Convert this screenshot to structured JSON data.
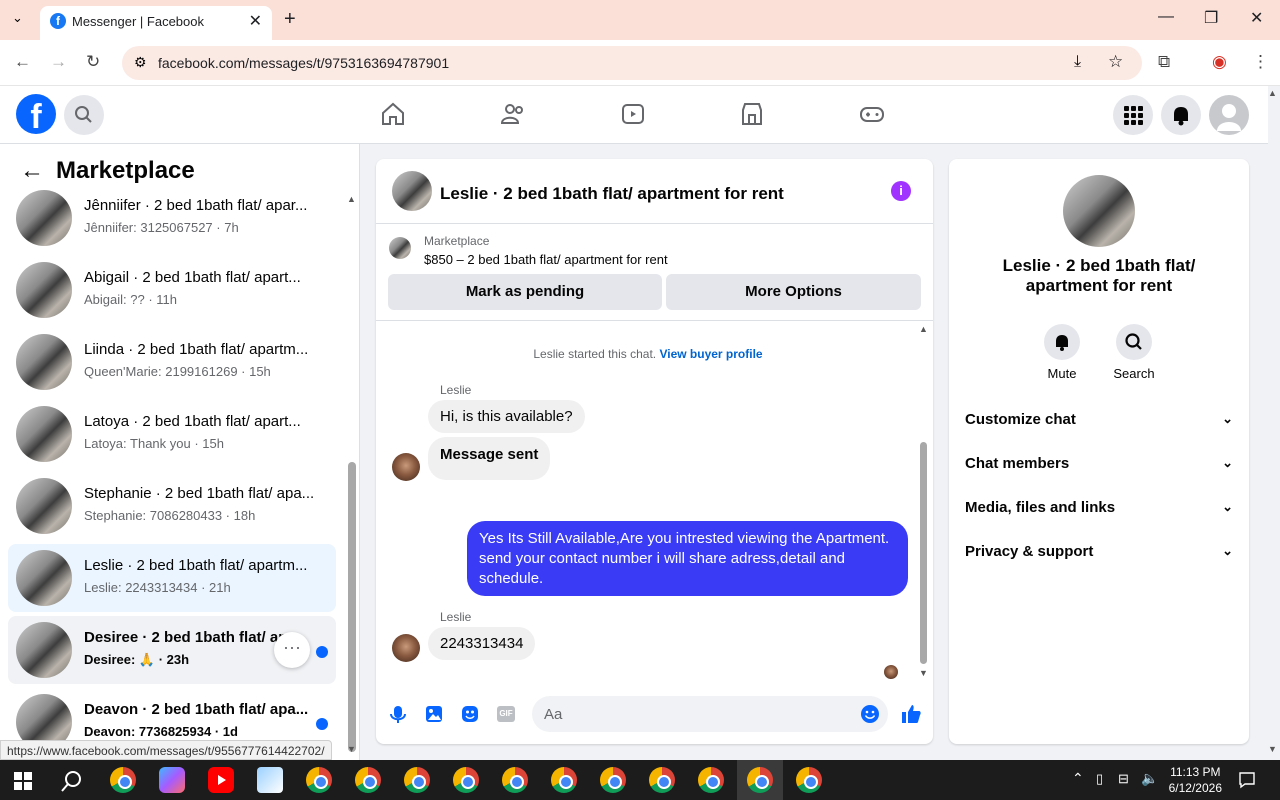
{
  "browser": {
    "tab_title": "Messenger | Facebook",
    "url": "facebook.com/messages/t/9753163694787901"
  },
  "left": {
    "title": "Marketplace",
    "conversations": [
      {
        "name": "Jênniifer · 2 bed 1bath flat/ apar...",
        "sub": "Jênniifer: 3125067527 · 7h"
      },
      {
        "name": "Abigail · 2 bed 1bath flat/ apart...",
        "sub": "Abigail: ?? · 11h"
      },
      {
        "name": "Liinda · 2 bed 1bath flat/ apartm...",
        "sub": "Queen'Marie: 2199161269 · 15h"
      },
      {
        "name": "Latoya · 2 bed 1bath flat/ apart...",
        "sub": "Latoya: Thank you · 15h"
      },
      {
        "name": "Stephanie · 2 bed 1bath flat/ apa...",
        "sub": "Stephanie: 7086280433 · 18h"
      },
      {
        "name": "Leslie · 2 bed 1bath flat/ apartm...",
        "sub": "Leslie: 2243313434 · 21h"
      },
      {
        "name": "Desiree · 2 bed 1bath flat/ ap...",
        "sub": "Desiree: 🙏 · 23h"
      },
      {
        "name": "Deavon · 2 bed 1bath flat/ apa...",
        "sub": "Deavon: 7736825934 · 1d"
      }
    ]
  },
  "chat": {
    "header_title": "Leslie · 2 bed 1bath flat/ apartment for rent",
    "marketplace_label": "Marketplace",
    "listing": "$850 – 2 bed 1bath flat/ apartment for rent",
    "mark_pending": "Mark as pending",
    "more_options": "More Options",
    "started_text": "Leslie started this chat.",
    "view_profile": "View buyer profile",
    "sender1": "Leslie",
    "msg1": "Hi, is this available?",
    "msg2": "Message sent",
    "msg3": "Yes Its Still Available,Are you intrested viewing the Apartment. send your contact number i will share adress,detail and schedule.",
    "sender2": "Leslie",
    "msg4": "2243313434",
    "input_placeholder": "Aa"
  },
  "right": {
    "title": "Leslie · 2 bed 1bath flat/ apartment for rent",
    "mute": "Mute",
    "search": "Search",
    "rows": [
      "Customize chat",
      "Chat members",
      "Media, files and links",
      "Privacy & support"
    ]
  },
  "status_url": "https://www.facebook.com/messages/t/9556777614422702/",
  "clock": {
    "time": "11:13 PM",
    "date": "6/12/2026"
  },
  "colors": {
    "accent": "#0866ff",
    "outgoing_bubble": "#3a3cf5",
    "info_icon": "#a033ff"
  }
}
